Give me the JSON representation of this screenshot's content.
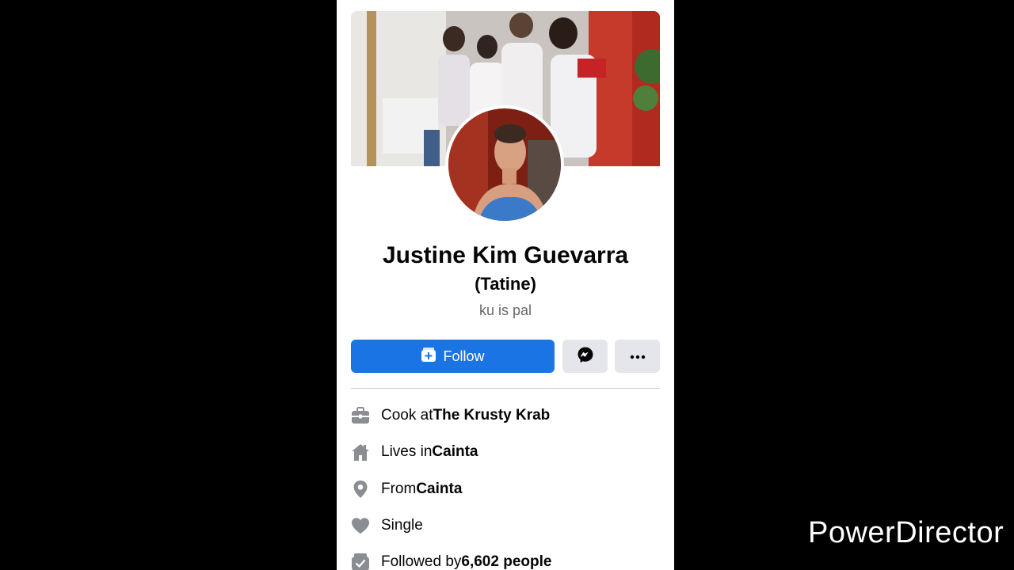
{
  "profile": {
    "name": "Justine Kim Guevarra",
    "nickname": "(Tatine)",
    "bio": "ku is pal"
  },
  "actions": {
    "follow_label": "Follow",
    "messenger_icon": "messenger-icon",
    "more_icon": "more-dots-icon"
  },
  "about": [
    {
      "icon": "briefcase-icon",
      "prefix": "Cook at ",
      "bold": "The Krusty Krab"
    },
    {
      "icon": "home-icon",
      "prefix": "Lives in ",
      "bold": "Cainta"
    },
    {
      "icon": "location-pin-icon",
      "prefix": "From ",
      "bold": "Cainta"
    },
    {
      "icon": "heart-icon",
      "prefix": "Single",
      "bold": ""
    },
    {
      "icon": "followers-icon",
      "prefix": "Followed by ",
      "bold": "6,602 people"
    }
  ],
  "watermark": "PowerDirector",
  "colors": {
    "follow_button": "#1b74e4",
    "secondary_button": "#e4e6eb",
    "secondary_text": "#65676b"
  }
}
